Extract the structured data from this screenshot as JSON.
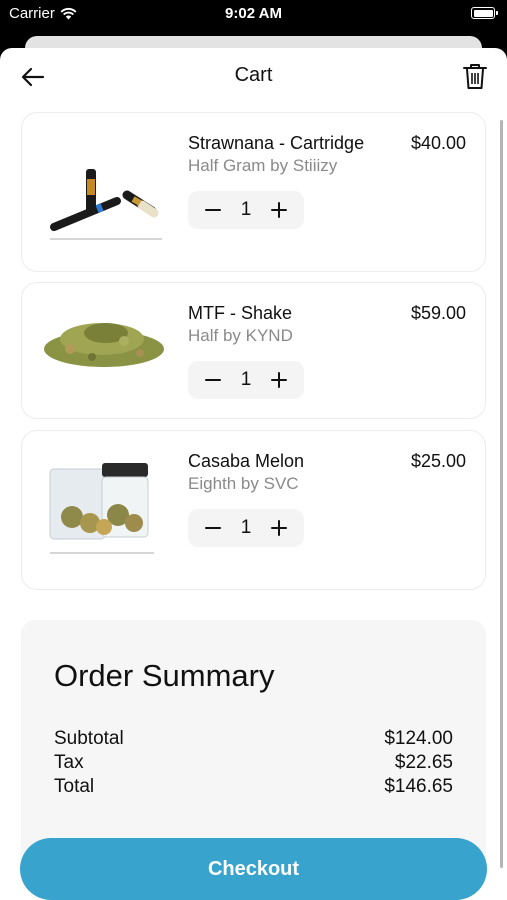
{
  "status_bar": {
    "carrier": "Carrier",
    "time": "9:02 AM"
  },
  "header": {
    "title": "Cart"
  },
  "cart_items": [
    {
      "name": "Strawnana - Cartridge",
      "subtitle": "Half Gram by Stiiizy",
      "price": "$40.00",
      "quantity": "1"
    },
    {
      "name": "MTF - Shake",
      "subtitle": "Half by KYND",
      "price": "$59.00",
      "quantity": "1"
    },
    {
      "name": "Casaba Melon",
      "subtitle": "Eighth by SVC",
      "price": "$25.00",
      "quantity": "1"
    }
  ],
  "summary": {
    "heading": "Order Summary",
    "subtotal_label": "Subtotal",
    "subtotal_value": "$124.00",
    "tax_label": "Tax",
    "tax_value": "$22.65",
    "total_label": "Total",
    "total_value": "$146.65"
  },
  "checkout": {
    "label": "Checkout"
  },
  "colors": {
    "accent": "#38a3cc",
    "summary_bg": "#f6f6f6",
    "subtitle_text": "#8a8a8a"
  }
}
